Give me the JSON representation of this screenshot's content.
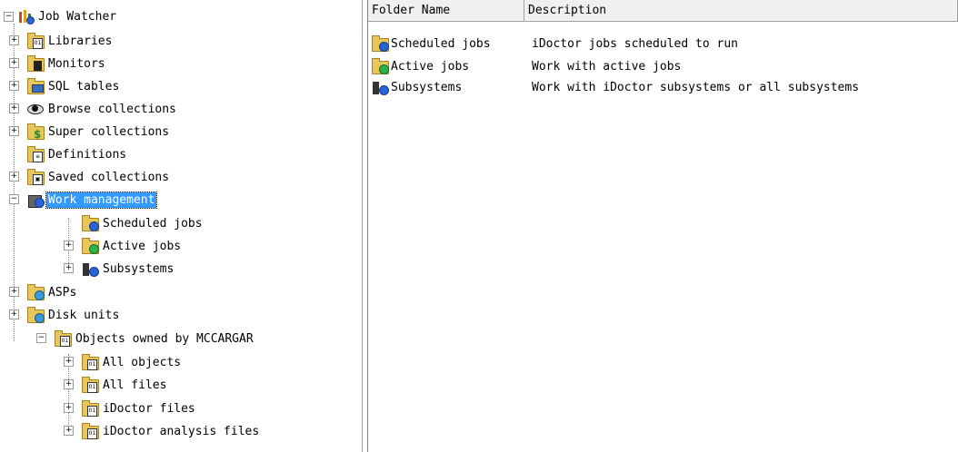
{
  "tree": {
    "root": {
      "label": "Job Watcher"
    },
    "items": [
      {
        "label": "Libraries"
      },
      {
        "label": "Monitors"
      },
      {
        "label": "SQL tables"
      },
      {
        "label": "Browse collections"
      },
      {
        "label": "Super collections"
      },
      {
        "label": "Definitions"
      },
      {
        "label": "Saved collections"
      },
      {
        "label": "Work management"
      },
      {
        "label": "Scheduled jobs"
      },
      {
        "label": "Active jobs"
      },
      {
        "label": "Subsystems"
      },
      {
        "label": "ASPs"
      },
      {
        "label": "Disk units"
      },
      {
        "label": "Objects owned by MCCARGAR"
      },
      {
        "label": "All objects"
      },
      {
        "label": "All files"
      },
      {
        "label": "iDoctor files"
      },
      {
        "label": "iDoctor analysis files"
      }
    ]
  },
  "list": {
    "columns": [
      "Folder Name",
      "Description"
    ],
    "rows": [
      {
        "name": "Scheduled jobs",
        "desc": "iDoctor jobs scheduled to run"
      },
      {
        "name": "Active jobs",
        "desc": "Work with active jobs"
      },
      {
        "name": "Subsystems",
        "desc": "Work with iDoctor subsystems or all subsystems"
      }
    ]
  }
}
